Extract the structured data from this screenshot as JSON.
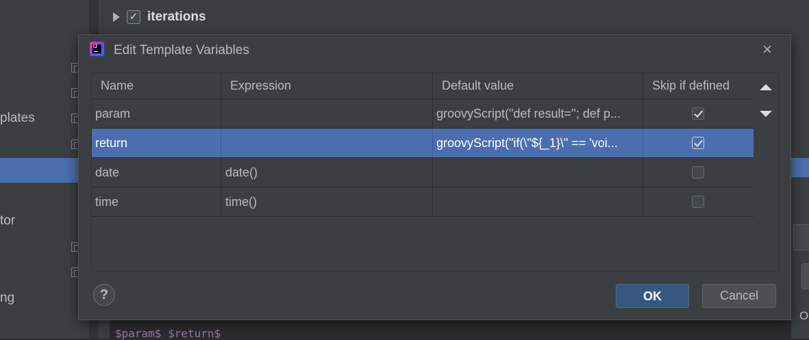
{
  "background": {
    "left_items": [
      "plates",
      "tor",
      "ng"
    ],
    "tree_item_label": "iterations",
    "tree_item_checked": true,
    "right_text": "O",
    "editor_text": "$param$ $return$"
  },
  "dialog": {
    "title": "Edit Template Variables",
    "close_icon": "close-icon",
    "columns": [
      "Name",
      "Expression",
      "Default value",
      "Skip if defined"
    ],
    "rows": [
      {
        "name": "param",
        "expression": "",
        "default_value": "groovyScript(\"def result=''; def p...",
        "skip_if_defined": true,
        "selected": false
      },
      {
        "name": "return",
        "expression": "",
        "default_value": "groovyScript(\"if(\\\"${_1}\\\" == 'voi...",
        "skip_if_defined": true,
        "selected": true
      },
      {
        "name": "date",
        "expression": "date()",
        "default_value": "",
        "skip_if_defined": false,
        "selected": false
      },
      {
        "name": "time",
        "expression": "time()",
        "default_value": "",
        "skip_if_defined": false,
        "selected": false
      }
    ],
    "move_up_icon": "arrow-up-icon",
    "move_down_icon": "arrow-down-icon",
    "help_label": "?",
    "ok_label": "OK",
    "cancel_label": "Cancel",
    "app_icon_text": "IJ"
  },
  "colors": {
    "selection": "#4b6eaf",
    "dialog_bg": "#3c3f41",
    "ok_button": "#365880"
  }
}
